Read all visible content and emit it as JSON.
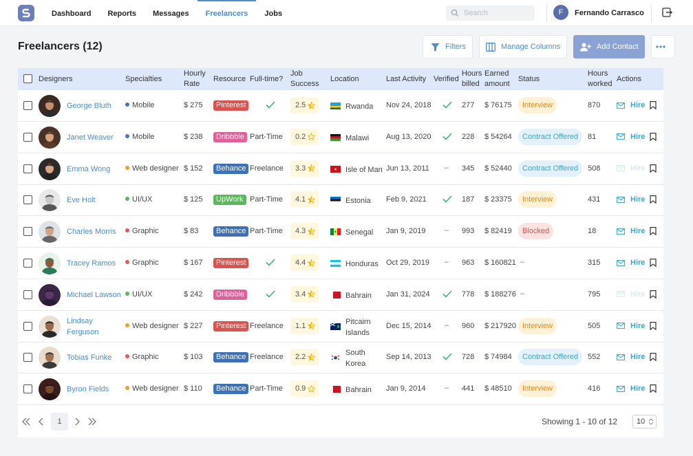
{
  "nav": {
    "items": [
      "Dashboard",
      "Reports",
      "Messages",
      "Freelancers",
      "Jobs"
    ],
    "active": 3,
    "search_placeholder": "Search",
    "user_initial": "F",
    "user_name": "Fernando Carrasco"
  },
  "page": {
    "title": "Freelancers (12)",
    "filters_label": "Filters",
    "manage_columns_label": "Manage Columns",
    "add_contact_label": "Add Contact"
  },
  "table": {
    "headers": {
      "designers": "Designers",
      "specialties": "Specialties",
      "hourly_rate_1": "Hourly",
      "hourly_rate_2": "Rate",
      "resource": "Resource",
      "fulltime": "Full-time?",
      "job_success_1": "Job",
      "job_success_2": "Success",
      "location": "Location",
      "last_activity": "Last Activity",
      "verified": "Verified",
      "hours_billed_1": "Hours",
      "hours_billed_2": "billed",
      "earned_1": "Earned",
      "earned_2": "amount",
      "status": "Status",
      "hours_worked_1": "Hours",
      "hours_worked_2": "worked",
      "actions": "Actions"
    },
    "hire_label": "Hire",
    "rows": [
      {
        "name1": "George Bluth",
        "name2": "",
        "specialty": "Mobile",
        "spec_color": "#4b74c2",
        "rate": "$ 275",
        "resource": "Pinterest",
        "resource_color": "#d9534f",
        "fulltime": "check",
        "success": "2.5",
        "star_fill": "half",
        "location1": "Rwanda",
        "location2": "",
        "flag": "rwanda",
        "last_activity": "Nov 24, 2018",
        "verified": true,
        "billed": "277",
        "earned": "$ 76175",
        "status": "Interview",
        "hours_worked": "870",
        "hire_active": true
      },
      {
        "name1": "Janet Weaver",
        "name2": "",
        "specialty": "Mobile",
        "spec_color": "#4b74c2",
        "rate": "$ 238",
        "resource": "Dribbble",
        "resource_color": "#e0609a",
        "fulltime": "Part-Time",
        "success": "0.2",
        "star_fill": "empty",
        "location1": "Malawi",
        "location2": "",
        "flag": "malawi",
        "last_activity": "Aug 13, 2020",
        "verified": true,
        "billed": "228",
        "earned": "$ 54264",
        "status": "Contract Offered",
        "hours_worked": "81",
        "hire_active": true
      },
      {
        "name1": "Emma Wong",
        "name2": "",
        "specialty": "Web designer",
        "spec_color": "#f0a020",
        "rate": "$ 152",
        "resource": "Behance",
        "resource_color": "#3f6fb5",
        "fulltime": "Freelance",
        "success": "3.3",
        "star_fill": "half",
        "location1": "Isle of Man",
        "location2": "",
        "flag": "isleofman",
        "last_activity": "Jun 13, 2011",
        "verified": false,
        "billed": "345",
        "earned": "$ 52440",
        "status": "Contract Offered",
        "hours_worked": "508",
        "hire_active": false
      },
      {
        "name1": "Eve Holt",
        "name2": "",
        "specialty": "UI/UX",
        "spec_color": "#5cb85c",
        "rate": "$ 125",
        "resource": "UpWork",
        "resource_color": "#5cb85c",
        "fulltime": "Part-Time",
        "success": "4.1",
        "star_fill": "half",
        "location1": "Estonia",
        "location2": "",
        "flag": "estonia",
        "last_activity": "Feb 9, 2021",
        "verified": true,
        "billed": "187",
        "earned": "$ 23375",
        "status": "Interview",
        "hours_worked": "431",
        "hire_active": true
      },
      {
        "name1": "Charles Morris",
        "name2": "",
        "specialty": "Graphic",
        "spec_color": "#e05a5a",
        "rate": "$ 83",
        "resource": "Behance",
        "resource_color": "#3f6fb5",
        "fulltime": "Part-Time",
        "success": "4.3",
        "star_fill": "half",
        "location1": "Senegal",
        "location2": "",
        "flag": "senegal",
        "last_activity": "Jan 9, 2019",
        "verified": false,
        "billed": "993",
        "earned": "$ 82419",
        "status": "Blocked",
        "hours_worked": "18",
        "hire_active": true
      },
      {
        "name1": "Tracey Ramos",
        "name2": "",
        "specialty": "Graphic",
        "spec_color": "#e05a5a",
        "rate": "$ 167",
        "resource": "Pinterest",
        "resource_color": "#d9534f",
        "fulltime": "check",
        "success": "4.4",
        "star_fill": "half",
        "location1": "Honduras",
        "location2": "",
        "flag": "honduras",
        "last_activity": "Oct 29, 2019",
        "verified": false,
        "billed": "963",
        "earned": "$ 160821",
        "status": "",
        "hours_worked": "315",
        "hire_active": true
      },
      {
        "name1": "Michael Lawson",
        "name2": "",
        "specialty": "UI/UX",
        "spec_color": "#5cb85c",
        "rate": "$ 242",
        "resource": "Dribbble",
        "resource_color": "#e0609a",
        "fulltime": "check",
        "success": "3.4",
        "star_fill": "half",
        "location1": "Bahrain",
        "location2": "",
        "flag": "bahrain",
        "last_activity": "Jan 31, 2024",
        "verified": true,
        "billed": "778",
        "earned": "$ 188276",
        "status": "",
        "hours_worked": "795",
        "hire_active": false
      },
      {
        "name1": "Lindsay",
        "name2": "Ferguson",
        "specialty": "Web designer",
        "spec_color": "#f0a020",
        "rate": "$ 227",
        "resource": "Pinterest",
        "resource_color": "#d9534f",
        "fulltime": "Freelance",
        "success": "1.1",
        "star_fill": "half",
        "location1": "Pitcairn",
        "location2": "Islands",
        "flag": "pitcairn",
        "last_activity": "Dec 15, 2014",
        "verified": false,
        "billed": "960",
        "earned": "$ 217920",
        "status": "Interview",
        "hours_worked": "505",
        "hire_active": true
      },
      {
        "name1": "Tobias Funke",
        "name2": "",
        "specialty": "Graphic",
        "spec_color": "#e05a5a",
        "rate": "$ 103",
        "resource": "Behance",
        "resource_color": "#3f6fb5",
        "fulltime": "Freelance",
        "success": "2.2",
        "star_fill": "half",
        "location1": "South",
        "location2": "Korea",
        "flag": "korea",
        "last_activity": "Sep 14, 2013",
        "verified": true,
        "billed": "728",
        "earned": "$ 74984",
        "status": "Contract Offered",
        "hours_worked": "552",
        "hire_active": true
      },
      {
        "name1": "Byron Fields",
        "name2": "",
        "specialty": "Web designer",
        "spec_color": "#f0a020",
        "rate": "$ 110",
        "resource": "Behance",
        "resource_color": "#3f6fb5",
        "fulltime": "Part-Time",
        "success": "0.9",
        "star_fill": "empty",
        "location1": "Bahrain",
        "location2": "",
        "flag": "bahrain",
        "last_activity": "Jan 9, 2014",
        "verified": false,
        "billed": "441",
        "earned": "$ 48510",
        "status": "Interview",
        "hours_worked": "416",
        "hire_active": true
      }
    ]
  },
  "pagination": {
    "current_page": "1",
    "showing_text": "Showing 1 - 10 of 12",
    "page_size": "10"
  },
  "colors": {
    "accent": "#4b8ec9",
    "header_bg": "#dde9fa",
    "hire": "#3aa6c9",
    "check": "#3cb371"
  }
}
